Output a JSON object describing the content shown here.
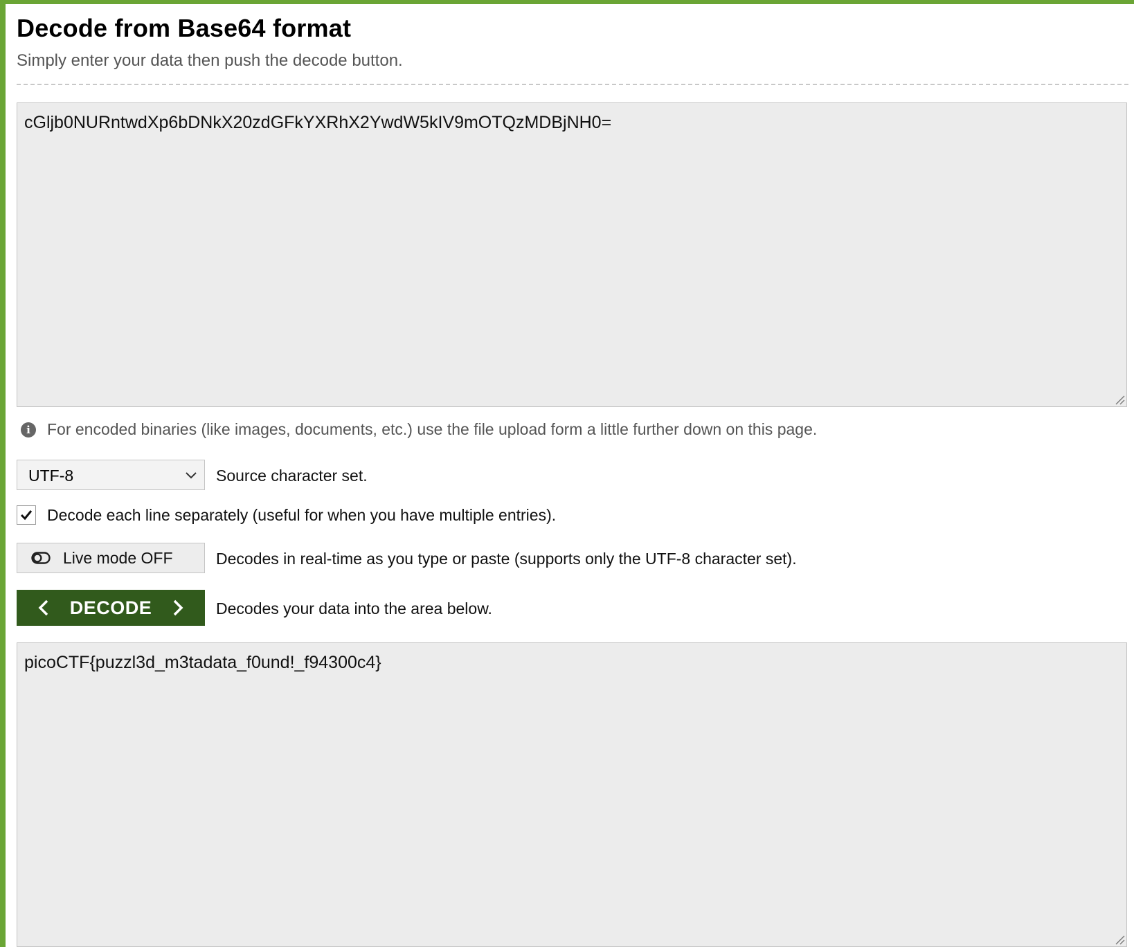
{
  "colors": {
    "accent": "#6aa535",
    "decode_button_bg": "#315a1c",
    "textarea_bg": "#ececec"
  },
  "header": {
    "title": "Decode from Base64 format",
    "subtitle": "Simply enter your data then push the decode button."
  },
  "input": {
    "value": "cGljb0NURntwdXp6bDNkX20zdGFkYXRhX2YwdW5kIV9mOTQzMDBjNH0="
  },
  "info": {
    "icon": "info-icon",
    "text": "For encoded binaries (like images, documents, etc.) use the file upload form a little further down on this page."
  },
  "charset": {
    "selected": "UTF-8",
    "label": "Source character set."
  },
  "line_option": {
    "checked": true,
    "label": "Decode each line separately (useful for when you have multiple entries)."
  },
  "live_mode": {
    "button_label": "Live mode OFF",
    "description": "Decodes in real-time as you type or paste (supports only the UTF-8 character set)."
  },
  "decode": {
    "button_label": "DECODE",
    "description": "Decodes your data into the area below."
  },
  "output": {
    "value": "picoCTF{puzzl3d_m3tadata_f0und!_f94300c4}"
  }
}
